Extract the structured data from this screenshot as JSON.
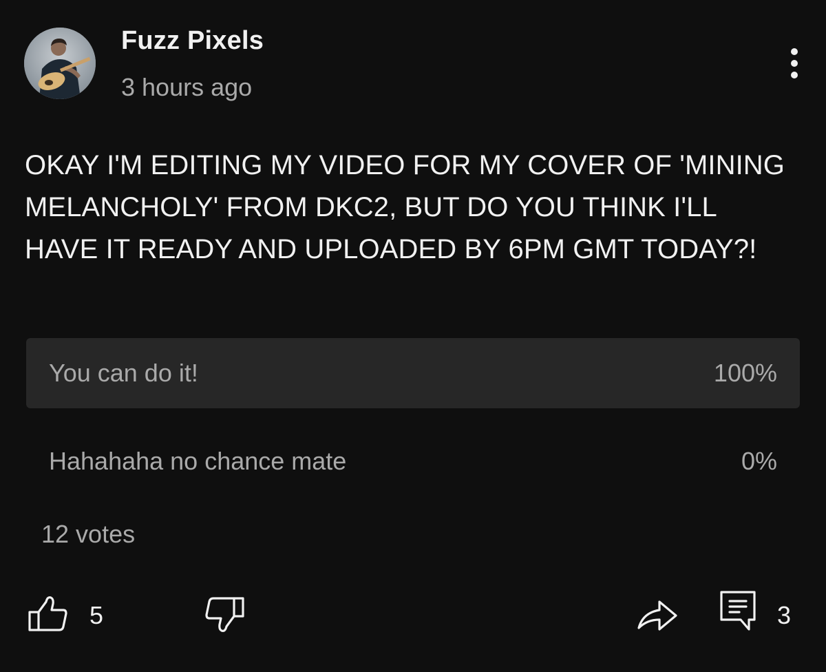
{
  "author": {
    "name": "Fuzz Pixels",
    "time": "3 hours ago",
    "avatar": "avatar-photo-guitarist"
  },
  "post": {
    "text": "OKAY I'M EDITING MY VIDEO FOR MY COVER OF 'MINING MELANCHOLY' FROM DKC2, BUT DO YOU THINK I'LL HAVE IT READY AND UPLOADED BY 6PM GMT TODAY?!"
  },
  "poll": {
    "options": [
      {
        "label": "You can do it!",
        "percent": "100%",
        "fraction": 1.0
      },
      {
        "label": "Hahahaha no chance mate",
        "percent": "0%",
        "fraction": 0.0
      }
    ],
    "votes": "12 votes"
  },
  "actions": {
    "likes": "5",
    "comments": "3",
    "icons": [
      "thumbs-up-icon",
      "thumbs-down-icon",
      "share-icon",
      "comment-icon",
      "more-vertical-icon"
    ]
  },
  "colors": {
    "background": "#0f0f0f",
    "primary_text": "#f1f1f1",
    "secondary_text": "#aaaaaa",
    "poll_fill": "#272727"
  }
}
